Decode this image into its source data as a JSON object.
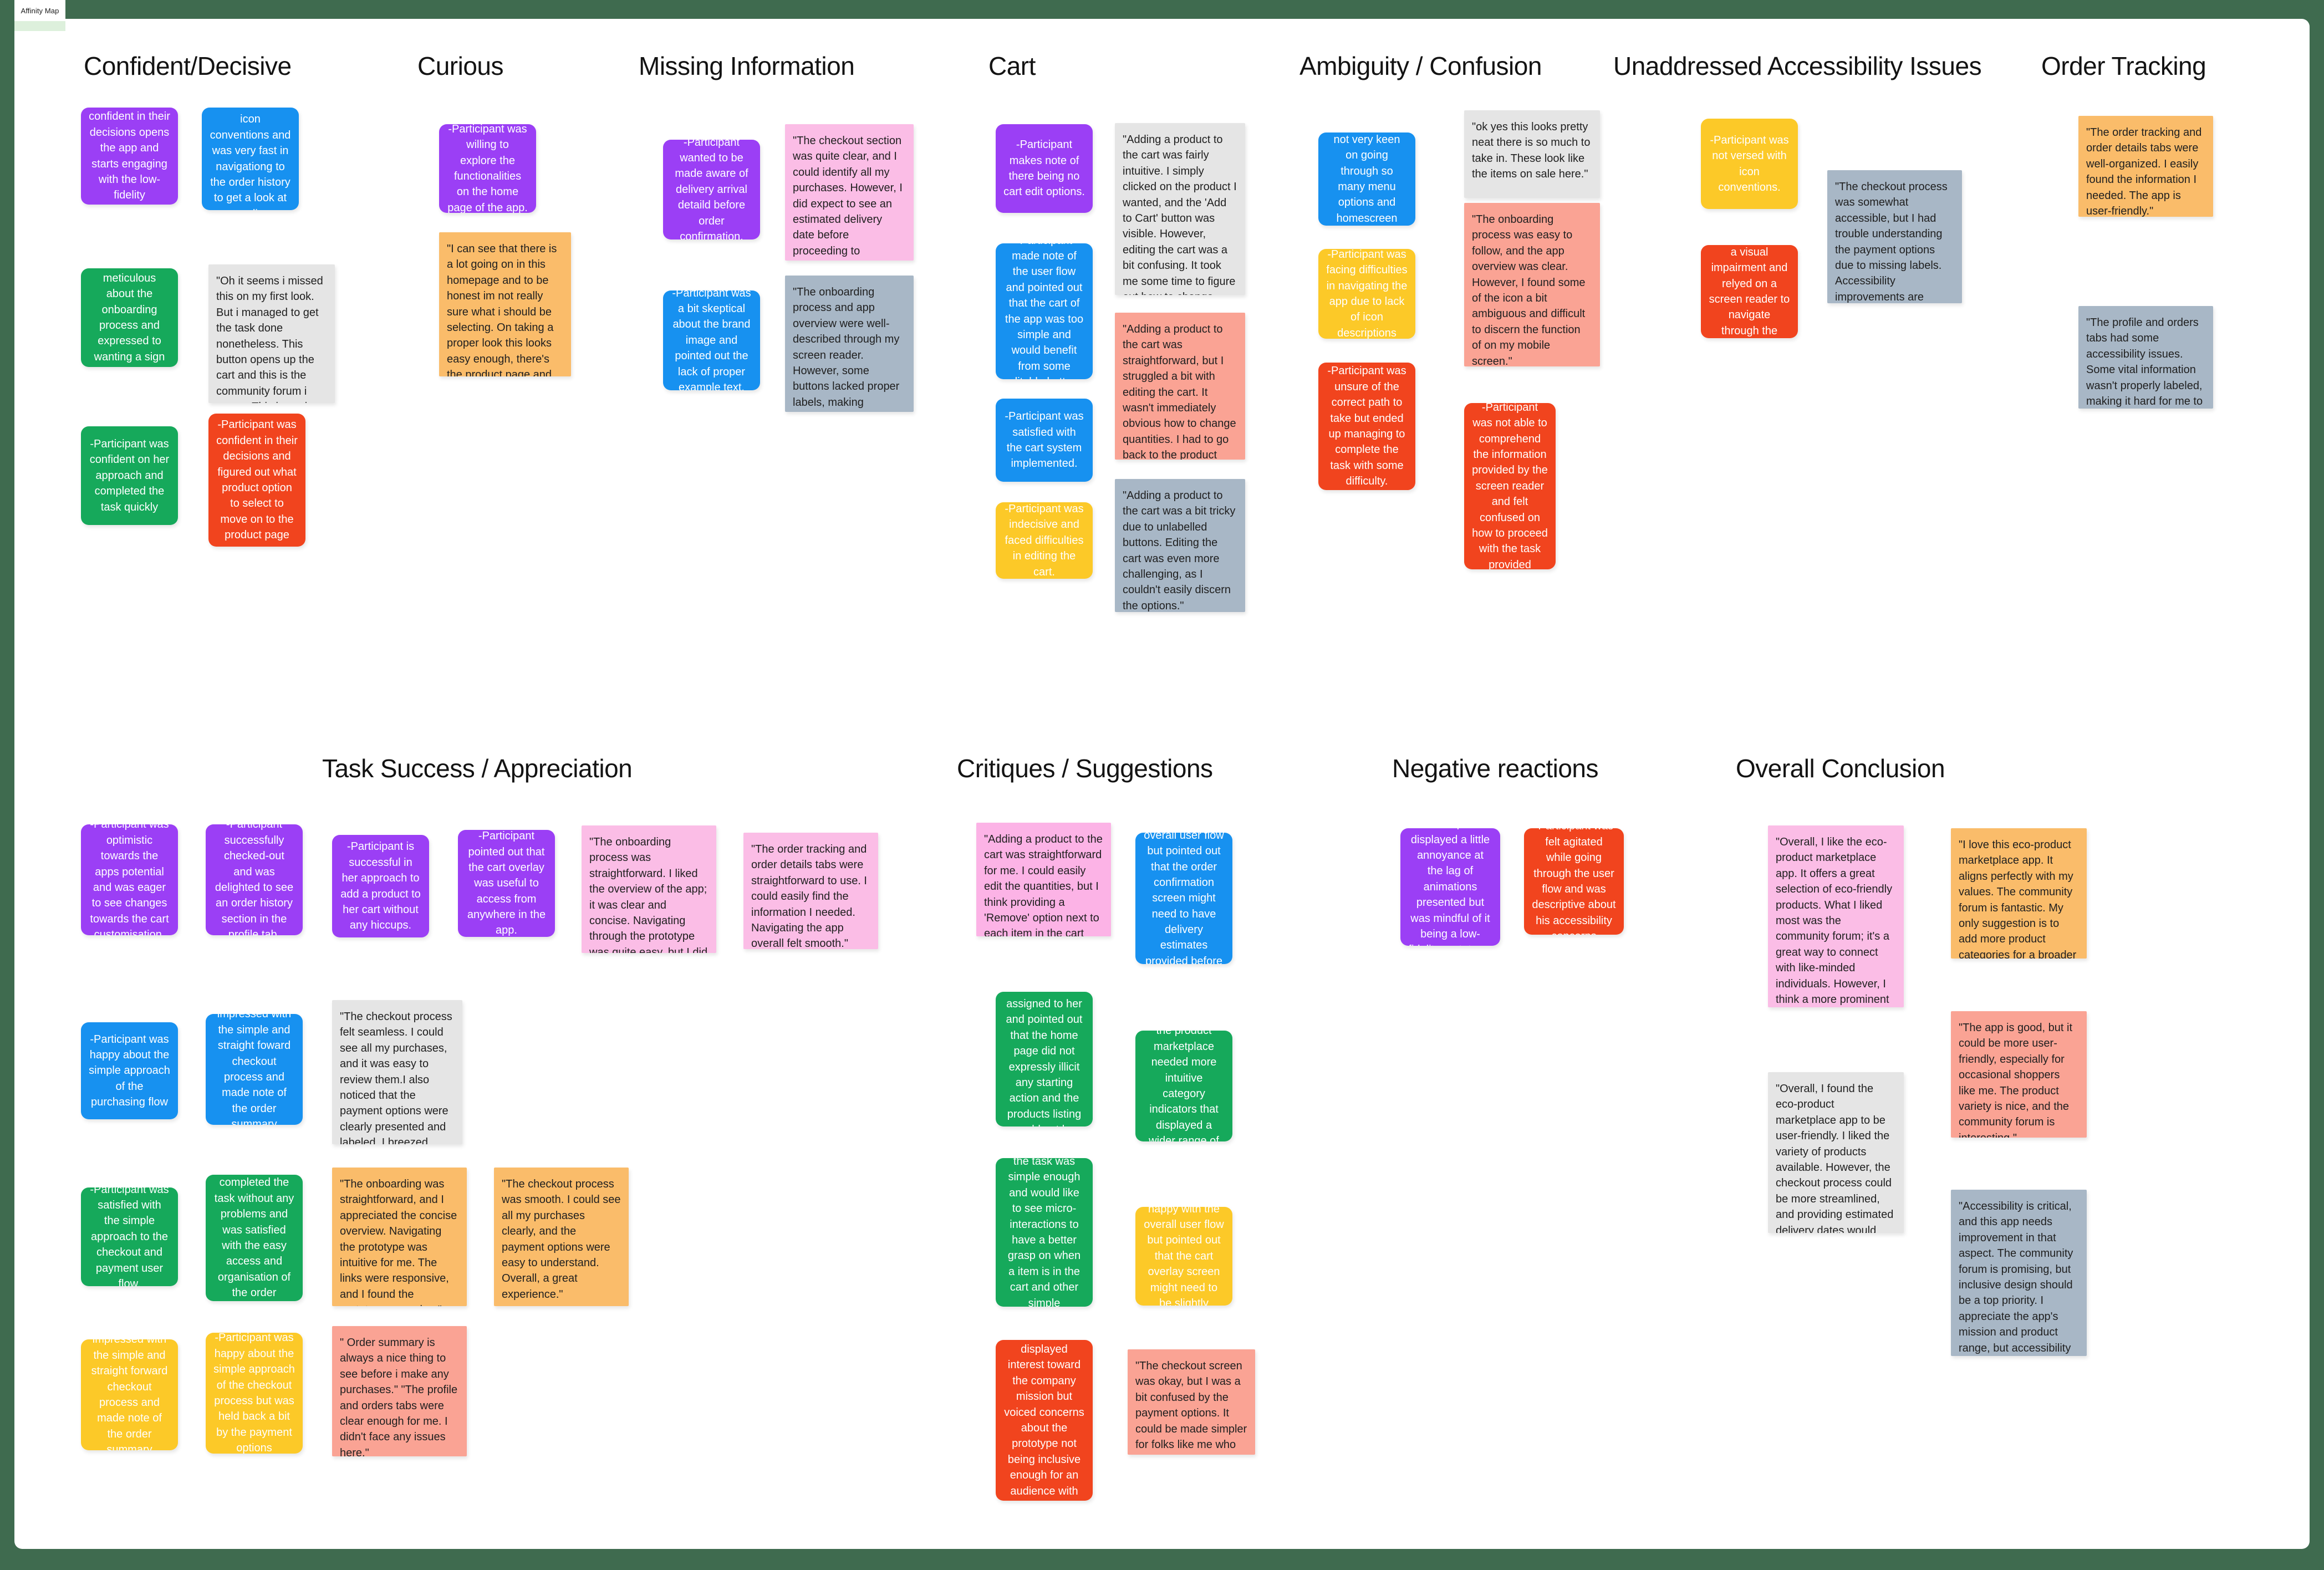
{
  "tab": {
    "label": "Affinity Map"
  },
  "palette": {
    "purple": "#9B3FF5",
    "blue": "#1791F0",
    "green": "#16A95B",
    "red": "#F1441E",
    "yellow": "#FCC928",
    "orange": "#FABC6A",
    "pink_light": "#FBBDE6",
    "pink_hot": "#FCB3E6",
    "salmon": "#FAA394",
    "gray_light": "#E5E5E5",
    "gray_blue": "#A8B7C6",
    "teal_green": "#17A75C",
    "canvas": "#FFFFFF",
    "page_bg": "#3F6B4F"
  },
  "columns": [
    {
      "id": "confident-decisive",
      "title": "Confident/Decisive"
    },
    {
      "id": "curious",
      "title": "Curious"
    },
    {
      "id": "missing-information",
      "title": "Missing Information"
    },
    {
      "id": "cart",
      "title": "Cart"
    },
    {
      "id": "ambiguity-confusion",
      "title": "Ambiguity / Confusion"
    },
    {
      "id": "accessibility",
      "title": "Unaddressed Accessibility Issues"
    },
    {
      "id": "order-tracking",
      "title": "Order Tracking"
    },
    {
      "id": "task-success",
      "title": "Task Success / Appreciation"
    },
    {
      "id": "critiques",
      "title": "Critiques / Suggestions"
    },
    {
      "id": "negative-reactions",
      "title": "Negative reactions"
    },
    {
      "id": "overall-conclusion",
      "title": "Overall Conclusion"
    }
  ],
  "notes": {
    "n01": "-Participant was confident in their decisions opens the app and starts engaging with the low-fidelity prototype.",
    "n02": "-Participant was well versed in icon conventions and was very fast in navigationg to the order history to get a look at pending deliveries.",
    "n03": "-Participant was meticulous about the onboarding process and expressed to wanting a sign up page",
    "n04": "\"Oh it seems i missed this on my first look. But i managed to get the task done nonetheless. This button opens up the cart and this is the community forum i guess. This is easier than I thought.\"",
    "n05": "-Participant was confident on her approach and completed the task quickly",
    "n06": "-Participant was confident in their decisions and figured out what product option to select to move on to the product page",
    "n07": "-Participant was willing to explore the functionalities on the home page of the app.",
    "n08": "\"I can see that there is a lot going on in this homepage and to be honest im not really sure what i should be selecting. On taking a proper look this looks easy enough, there's the product page and there is add to cart\"",
    "n09": "-Participant wanted to be made aware of delivery arrival detaild before order confirmation.",
    "n10": "-Participant was a bit skeptical about the brand image and pointed out the lack of proper example text.",
    "n11": "\"The checkout section was quite clear, and I could identify all my purchases. However, I did expect to see an estimated delivery date before proceeding to payment. It would add more convenience.\"",
    "n12": "\"The onboarding process and app overview were well-described through my screen reader. However, some buttons lacked proper labels, making navigation a bit challenging.\"",
    "n13": "-Participant makes note of there being no cart edit options.",
    "n14": "-Participant made note of the user flow and pointed out that the cart of the app was too simple and would benefit from some editable buttons",
    "n15": "-Participant was satisfied with the cart system implemented.",
    "n16": "-Participant was indecisive and faced difficulties in editing the cart.",
    "n17": "\"Adding a product to the cart was fairly intuitive. I simply clicked on the product I wanted, and the 'Add to Cart' button was visible. However, editing the cart was a bit confusing. It took me some time to figure out how to change quantities and remove items.\"",
    "n18": "\"Adding a product to the cart was straightforward, but I struggled a bit with editing the cart. It wasn't immediately obvious how to change quantities. I had to go back to the product page to change the product quantities\"",
    "n19": "\"Adding a product to the cart was a bit tricky due to unlabelled buttons. Editing the cart was even more challenging, as I couldn't easily discern the options.\"",
    "n20": "-Participant was not very keen on going through so many menu options and homescreen tabs",
    "n21": "-Participant was facing difficulties in navigating the app due to lack of icon descriptions",
    "n22": "-Participant was unsure of the correct path to take but ended up managing to complete the task with some difficulty.",
    "n23": "\"ok yes this looks pretty neat there is so much to take in. These look like the items on sale here.\"",
    "n24": "\"The onboarding process was easy to follow, and the app overview was clear. However, I found some of the icon a bit ambiguous and difficult to discern the function of on my mobile screen.\"",
    "n25": "-Participant was not able to comprehend the information provided by the screen reader and felt confused on how to proceed with the task provided",
    "n26": "-Participant was not versed with icon conventions.",
    "n27": "-Participant had a visual impairment and relyed on a screen reader to navigate through the prototype",
    "n28": "\"The checkout process was somewhat accessible, but I had trouble understanding the payment options due to missing labels. Accessibility improvements are needed.\"",
    "n29": "\"The order tracking and order details tabs were well-organized. I easily found the information I needed. The app is user-friendly.\"",
    "n30": "\"The profile and orders tabs had some accessibility issues. Some vital information wasn't properly labeled, making it hard for me to comprehend.\"",
    "n31": "-Participant was optimistic towards the apps potential and was eager to see changes towards the cart customisation.",
    "n32": "-Participant successfully checked-out and was delighted to see an order history section in the profile tab.",
    "n33": "-Participant is successful in her approach to add a product to her cart without any hiccups.",
    "n34": "-Participant pointed out that the cart overlay was useful to access from anywhere in the app.",
    "n35": "\"The onboarding process was straightforward. I liked the overview of the app; it was clear and concise. Navigating through the prototype was quite easy, but I did find a few links that weren't working as expected.\"",
    "n36": "\"The order tracking and order details tabs were straightforward to use. I could easily find the information I needed. Navigating the app overall felt smooth.\"",
    "n37": "-Participant was happy about the simple approach of the purchasing flow",
    "n38": "-Participant was impressed with the simple and straight foward checkout process and made note of the order summary screen.",
    "n39": "\"The checkout process felt seamless. I could see all my purchases, and it was easy to review them.I also noticed that the payment options were clearly presented and labeled. I breezed through the flow very fast.\"",
    "n40": "-Participant was satisfied with the simple approach to the checkout and payment user flow.",
    "n41": "-Participant completed the task without any problems and was satisfied with the easy access and organisation of the order details.",
    "n42": "\"The onboarding was straightforward, and I appreciated the concise overview. Navigating the prototype was intuitive for me. The links were responsive, and I found the prototype engaging.\"",
    "n43": "\"The checkout process was smooth. I could see all my purchases clearly, and the payment options were easy to understand. Overall, a great experience.\"",
    "n44": "-Participant was impressed with the simple and straight forward checkout process and made note of the order summary screen.",
    "n45": "-Participant was happy about the simple approach of the checkout process but was held back a bit by the payment options",
    "n46": "\" Order summary is always a nice thing to see before i make any purchases.\" \"The profile and orders tabs were clear enough for me. I didn't face any issues here.\"",
    "n47": "\"Adding a product to the cart was straightforward for me. I could easily edit the quantities, but I think providing a 'Remove' option next to each item in the cart would be more user-friendly.\"",
    "n48": "-Participant was critical in the user role assigned to her and pointed out that the home page did not expressly illicit any starting action and the products listing could not be accessed directly.",
    "n49": "-Participant pointed out that the task was simple enough and would like to see micro-interactions to have a better grasp on when a item is in the cart and other simple indications of user journey.",
    "n50": "-Participant displayed interest toward the company mission but voiced concerns about the prototype not being inclusive enough for an audience with disabilities.",
    "n51": "-Participant was happy with the overall user flow but pointed out that the order confirmation screen might need to have delivery estimates provided before the payment section.",
    "n52": "-Participant felt the product marketplace needed more intuitive category indicators that displayed a wider range of products.",
    "n53": "-Participant was happy with the overall user flow but pointed out that the cart overlay screen might need to be slightly optimised",
    "n54": "\"The checkout screen was okay, but I was a bit confused by the payment options. It could be made simpler for folks like me who are not very tech-savvy.\"",
    "n55": "-Participant displayed a little annoyance at the lag of animations presented but was mindful of it being a low-fidelity prototype.",
    "n56": "-Participant was felt agitated while going through the user flow and was descriptive about his accessibility concerns",
    "n57": "\"Overall, I like the eco-product marketplace app. It offers a great selection of eco-friendly products. What I liked most was the community forum; it's a great way to connect with like-minded individuals. However, I think a more prominent search feature and clearer payment options during checkout could improve the experience.\"",
    "n58": "\"Overall, I found the eco-product marketplace app to be user-friendly. I liked the variety of products available. However, the checkout process could be more streamlined, and providing estimated delivery dates would enhance the experience. It's a promising platform.\"",
    "n59": "\"I love this eco-product marketplace app. It aligns perfectly with my values. The community forum is fantastic. My only suggestion is to add more product categories for a broader selection.\"",
    "n60": "\"The app is good, but it could be more user-friendly, especially for occasional shoppers like me. The product variety is nice, and the community forum is interesting.\"",
    "n61": "\"Accessibility is critical, and this app needs improvement in that aspect. The community forum is promising, but inclusive design should be a top priority. I appreciate the app's mission and product range, but accessibility is key for all users.\""
  }
}
